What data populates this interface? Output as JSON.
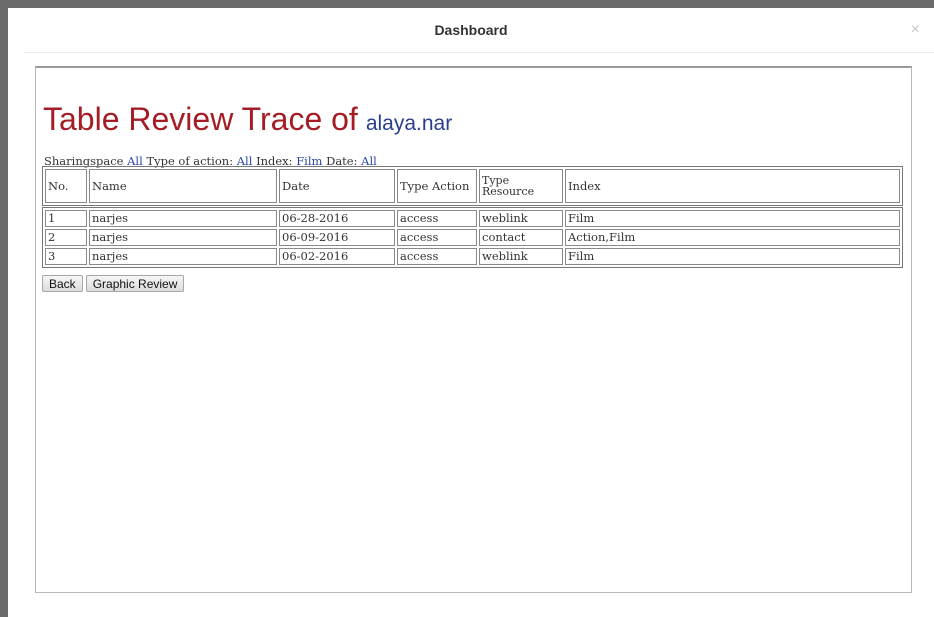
{
  "dialog": {
    "title": "Dashboard",
    "close_glyph": "×"
  },
  "report": {
    "heading": "Table Review Trace of",
    "username": "alaya.nar"
  },
  "filters": {
    "sharingspace_label": "Sharingspace",
    "sharingspace_value": "All",
    "action_label": "Type of action:",
    "action_value": "All",
    "index_label": "Index:",
    "index_value": "Film",
    "date_label": "Date:",
    "date_value": "All"
  },
  "table": {
    "headers": [
      "No.",
      "Name",
      "Date",
      "Type Action",
      "Type Resource",
      "Index"
    ],
    "rows": [
      [
        "1",
        "narjes",
        "06-28-2016",
        "access",
        "weblink",
        "Film"
      ],
      [
        "2",
        "narjes",
        "06-09-2016",
        "access",
        "contact",
        "Action,Film"
      ],
      [
        "3",
        "narjes",
        "06-02-2016",
        "access",
        "weblink",
        "Film"
      ]
    ]
  },
  "actions": {
    "back_label": "Back",
    "graphic_label": "Graphic Review"
  },
  "colors": {
    "heading": "#a51d24",
    "username": "#2a3e8f",
    "filter_value": "#2b47a6"
  },
  "icons": {
    "close": "close-icon"
  }
}
